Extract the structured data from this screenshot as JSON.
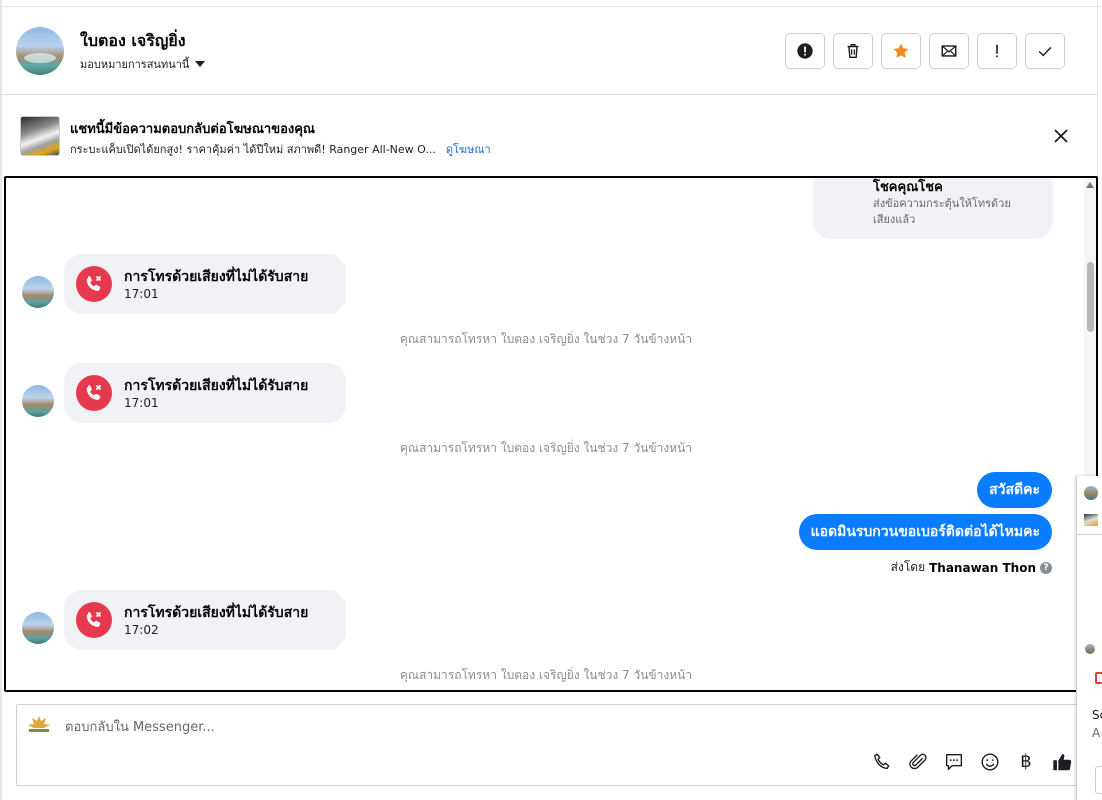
{
  "header": {
    "contact_name": "ใบตอง เจริญยิ่ง",
    "assign_label": "มอบหมายการสนทนานี้",
    "actions": [
      {
        "name": "report-icon",
        "label": "report"
      },
      {
        "name": "trash-icon",
        "label": "delete"
      },
      {
        "name": "star-icon",
        "label": "star"
      },
      {
        "name": "mail-icon",
        "label": "mark unread"
      },
      {
        "name": "exclamation-icon",
        "label": "follow up"
      },
      {
        "name": "check-icon",
        "label": "done"
      }
    ],
    "colors": {
      "star": "#f5871f"
    }
  },
  "ad_banner": {
    "title": "แชทนี้มีข้อความตอบกลับต่อโฆษณาของคุณ",
    "description": "กระบะแค็บเปิดได้ยกสูง! ราคาคุ้มค่า ได้ปีใหม่ สภาพดี! Ranger All-New O...",
    "link_label": "ดูโฆษณา"
  },
  "conversation": {
    "top_card": {
      "title": "โชคคุณโชค",
      "subtitle": "ส่งข้อความกระตุ้นให้โทรด้วยเสียงแล้ว"
    },
    "missed_calls": [
      {
        "title": "การโทรด้วยเสียงที่ไม่ได้รับสาย",
        "time": "17:01"
      },
      {
        "title": "การโทรด้วยเสียงที่ไม่ได้รับสาย",
        "time": "17:01"
      },
      {
        "title": "การโทรด้วยเสียงที่ไม่ได้รับสาย",
        "time": "17:02"
      }
    ],
    "system_note": "คุณสามารถโทรหา ใบตอง เจริญยิ่ง ในช่วง 7 วันข้างหน้า",
    "outgoing": [
      {
        "text": "สวัสดีคะ"
      },
      {
        "text": "แอดมินรบกวนขอเบอร์ติดต่อได้ไหมคะ"
      }
    ],
    "sent_by_prefix": "ส่งโดย",
    "sent_by_name": "Thanawan Thon",
    "colors": {
      "outgoing_bubble": "#0a7cff",
      "missed_call": "#e6394f"
    }
  },
  "composer": {
    "placeholder": "ตอบกลับใน Messenger...",
    "tools": [
      "phone-icon",
      "paperclip-icon",
      "saved-reply-icon",
      "emoji-icon",
      "baht-icon",
      "thumbs-up-icon"
    ],
    "baht_symbol": "฿"
  },
  "side_panel": {
    "text_1": "Sc",
    "text_2": "A"
  }
}
